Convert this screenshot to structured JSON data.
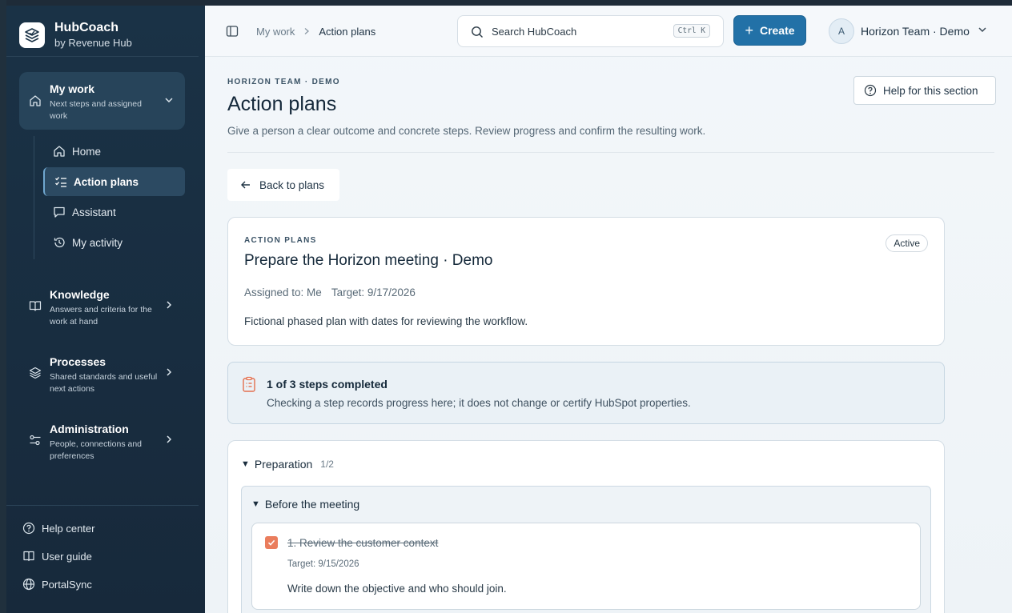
{
  "brand": {
    "name": "HubCoach",
    "subtitle": "by Revenue Hub"
  },
  "sidebar": {
    "my_work": {
      "title": "My work",
      "desc": "Next steps and assigned work"
    },
    "subitems": [
      {
        "label": "Home",
        "icon": "home-icon"
      },
      {
        "label": "Action plans",
        "icon": "checklist-icon",
        "active": true
      },
      {
        "label": "Assistant",
        "icon": "chat-icon"
      },
      {
        "label": "My activity",
        "icon": "history-icon"
      }
    ],
    "groups": [
      {
        "title": "Knowledge",
        "desc": "Answers and criteria for the work at hand",
        "icon": "book-icon"
      },
      {
        "title": "Processes",
        "desc": "Shared standards and useful next actions",
        "icon": "layers-icon"
      },
      {
        "title": "Administration",
        "desc": "People, connections and preferences",
        "icon": "sliders-icon"
      }
    ],
    "footer": [
      {
        "label": "Help center",
        "icon": "help-circle-icon"
      },
      {
        "label": "User guide",
        "icon": "book-open-icon"
      },
      {
        "label": "PortalSync",
        "icon": "globe-icon"
      }
    ]
  },
  "topbar": {
    "breadcrumb": [
      "My work",
      "Action plans"
    ],
    "search_label": "Search HubCoach",
    "search_shortcut": "Ctrl K",
    "create_label": "Create",
    "user_initial": "A",
    "user_name": "Horizon Team · Demo"
  },
  "header": {
    "eyebrow": "HORIZON TEAM · DEMO",
    "title": "Action plans",
    "subtitle": "Give a person a clear outcome and concrete steps. Review progress and confirm the resulting work.",
    "help_label": "Help for this section"
  },
  "back_label": "Back to plans",
  "plan": {
    "eyebrow": "ACTION PLANS",
    "title": "Prepare the Horizon meeting · Demo",
    "assigned": "Assigned to: Me",
    "target": "Target: 9/17/2026",
    "description": "Fictional phased plan with dates for reviewing the workflow.",
    "status": "Active"
  },
  "progress": {
    "title": "1 of 3 steps completed",
    "note": "Checking a step records progress here; it does not change or certify HubSpot properties."
  },
  "phase": {
    "name": "Preparation",
    "count": "1/2",
    "section": "Before the meeting",
    "step": {
      "title": "1. Review the customer context",
      "target": "Target: 9/15/2026",
      "description": "Write down the objective and who should join."
    }
  },
  "colors": {
    "sidebar_bg": "#1a3246",
    "accent": "#2271a7",
    "checkbox": "#ea7d5d"
  }
}
